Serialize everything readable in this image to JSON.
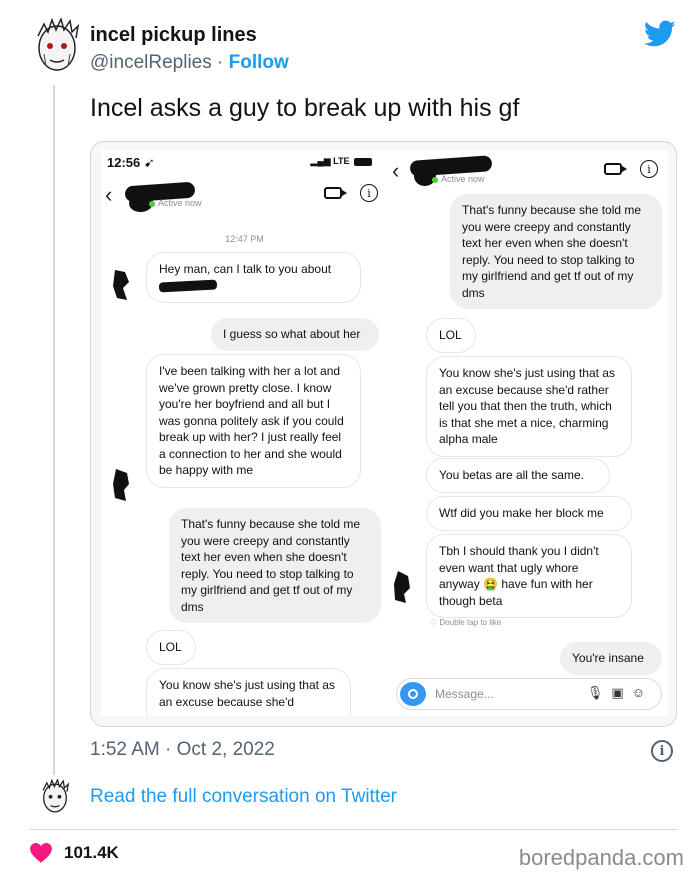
{
  "author": {
    "name": "incel pickup lines",
    "handle": "@incelReplies",
    "separator": "·",
    "follow_label": "Follow"
  },
  "tweet": {
    "text": "Incel asks a guy to break up with his gf",
    "time": "1:52 AM",
    "date": "Oct 2, 2022",
    "separator": "·",
    "read_full_label": "Read the full conversation on Twitter",
    "likes": "101.4K"
  },
  "watermark": "boredpanda.com",
  "colors": {
    "accent": "#1d9bf0",
    "heart": "#f91880",
    "instagram_blue": "#3797f0"
  },
  "screenshot_left": {
    "status_time": "12:56",
    "status_carrier": "LTE",
    "active_label": "Active now",
    "timestamp": "12:47 PM",
    "messages": [
      {
        "side": "in",
        "text_before": "Hey man, can I talk to you about"
      },
      {
        "side": "out",
        "text": "I guess so what about her"
      },
      {
        "side": "in",
        "text": "I've been talking with her a lot and we've grown pretty close. I know you're her boyfriend and all but I was gonna politely ask if you could break up with her? I just really feel a connection to her and she would be happy with me"
      },
      {
        "side": "out",
        "text": "That's funny because she told me you were creepy and constantly text her even when she doesn't reply. You need to stop talking to my girlfriend and get tf out of my dms"
      },
      {
        "side": "in",
        "text": "LOL"
      },
      {
        "side": "in",
        "text": "You know she's just using that as an excuse because she'd"
      }
    ]
  },
  "screenshot_right": {
    "active_label": "Active now",
    "messages": [
      {
        "side": "out",
        "text": "That's funny because she told me you were creepy and constantly text her even when she doesn't reply. You need to stop talking to my girlfriend and get tf out of my dms"
      },
      {
        "side": "in",
        "text": "LOL"
      },
      {
        "side": "in",
        "text": "You know she's just using that as an excuse because she'd rather tell you that then the truth, which is that she met a nice, charming alpha male"
      },
      {
        "side": "in",
        "text": "You betas are all the same."
      },
      {
        "side": "in",
        "text": "Wtf did you make her block me"
      },
      {
        "side": "in",
        "text_before": "Tbh I should thank you I didn't even want that ugly whore anyway",
        "emoji": "🤮",
        "text_after": "have fun with her though beta"
      },
      {
        "side": "out",
        "text": "You're insane"
      }
    ],
    "reaction_hint": "Double tap to like",
    "composer_placeholder": "Message..."
  }
}
